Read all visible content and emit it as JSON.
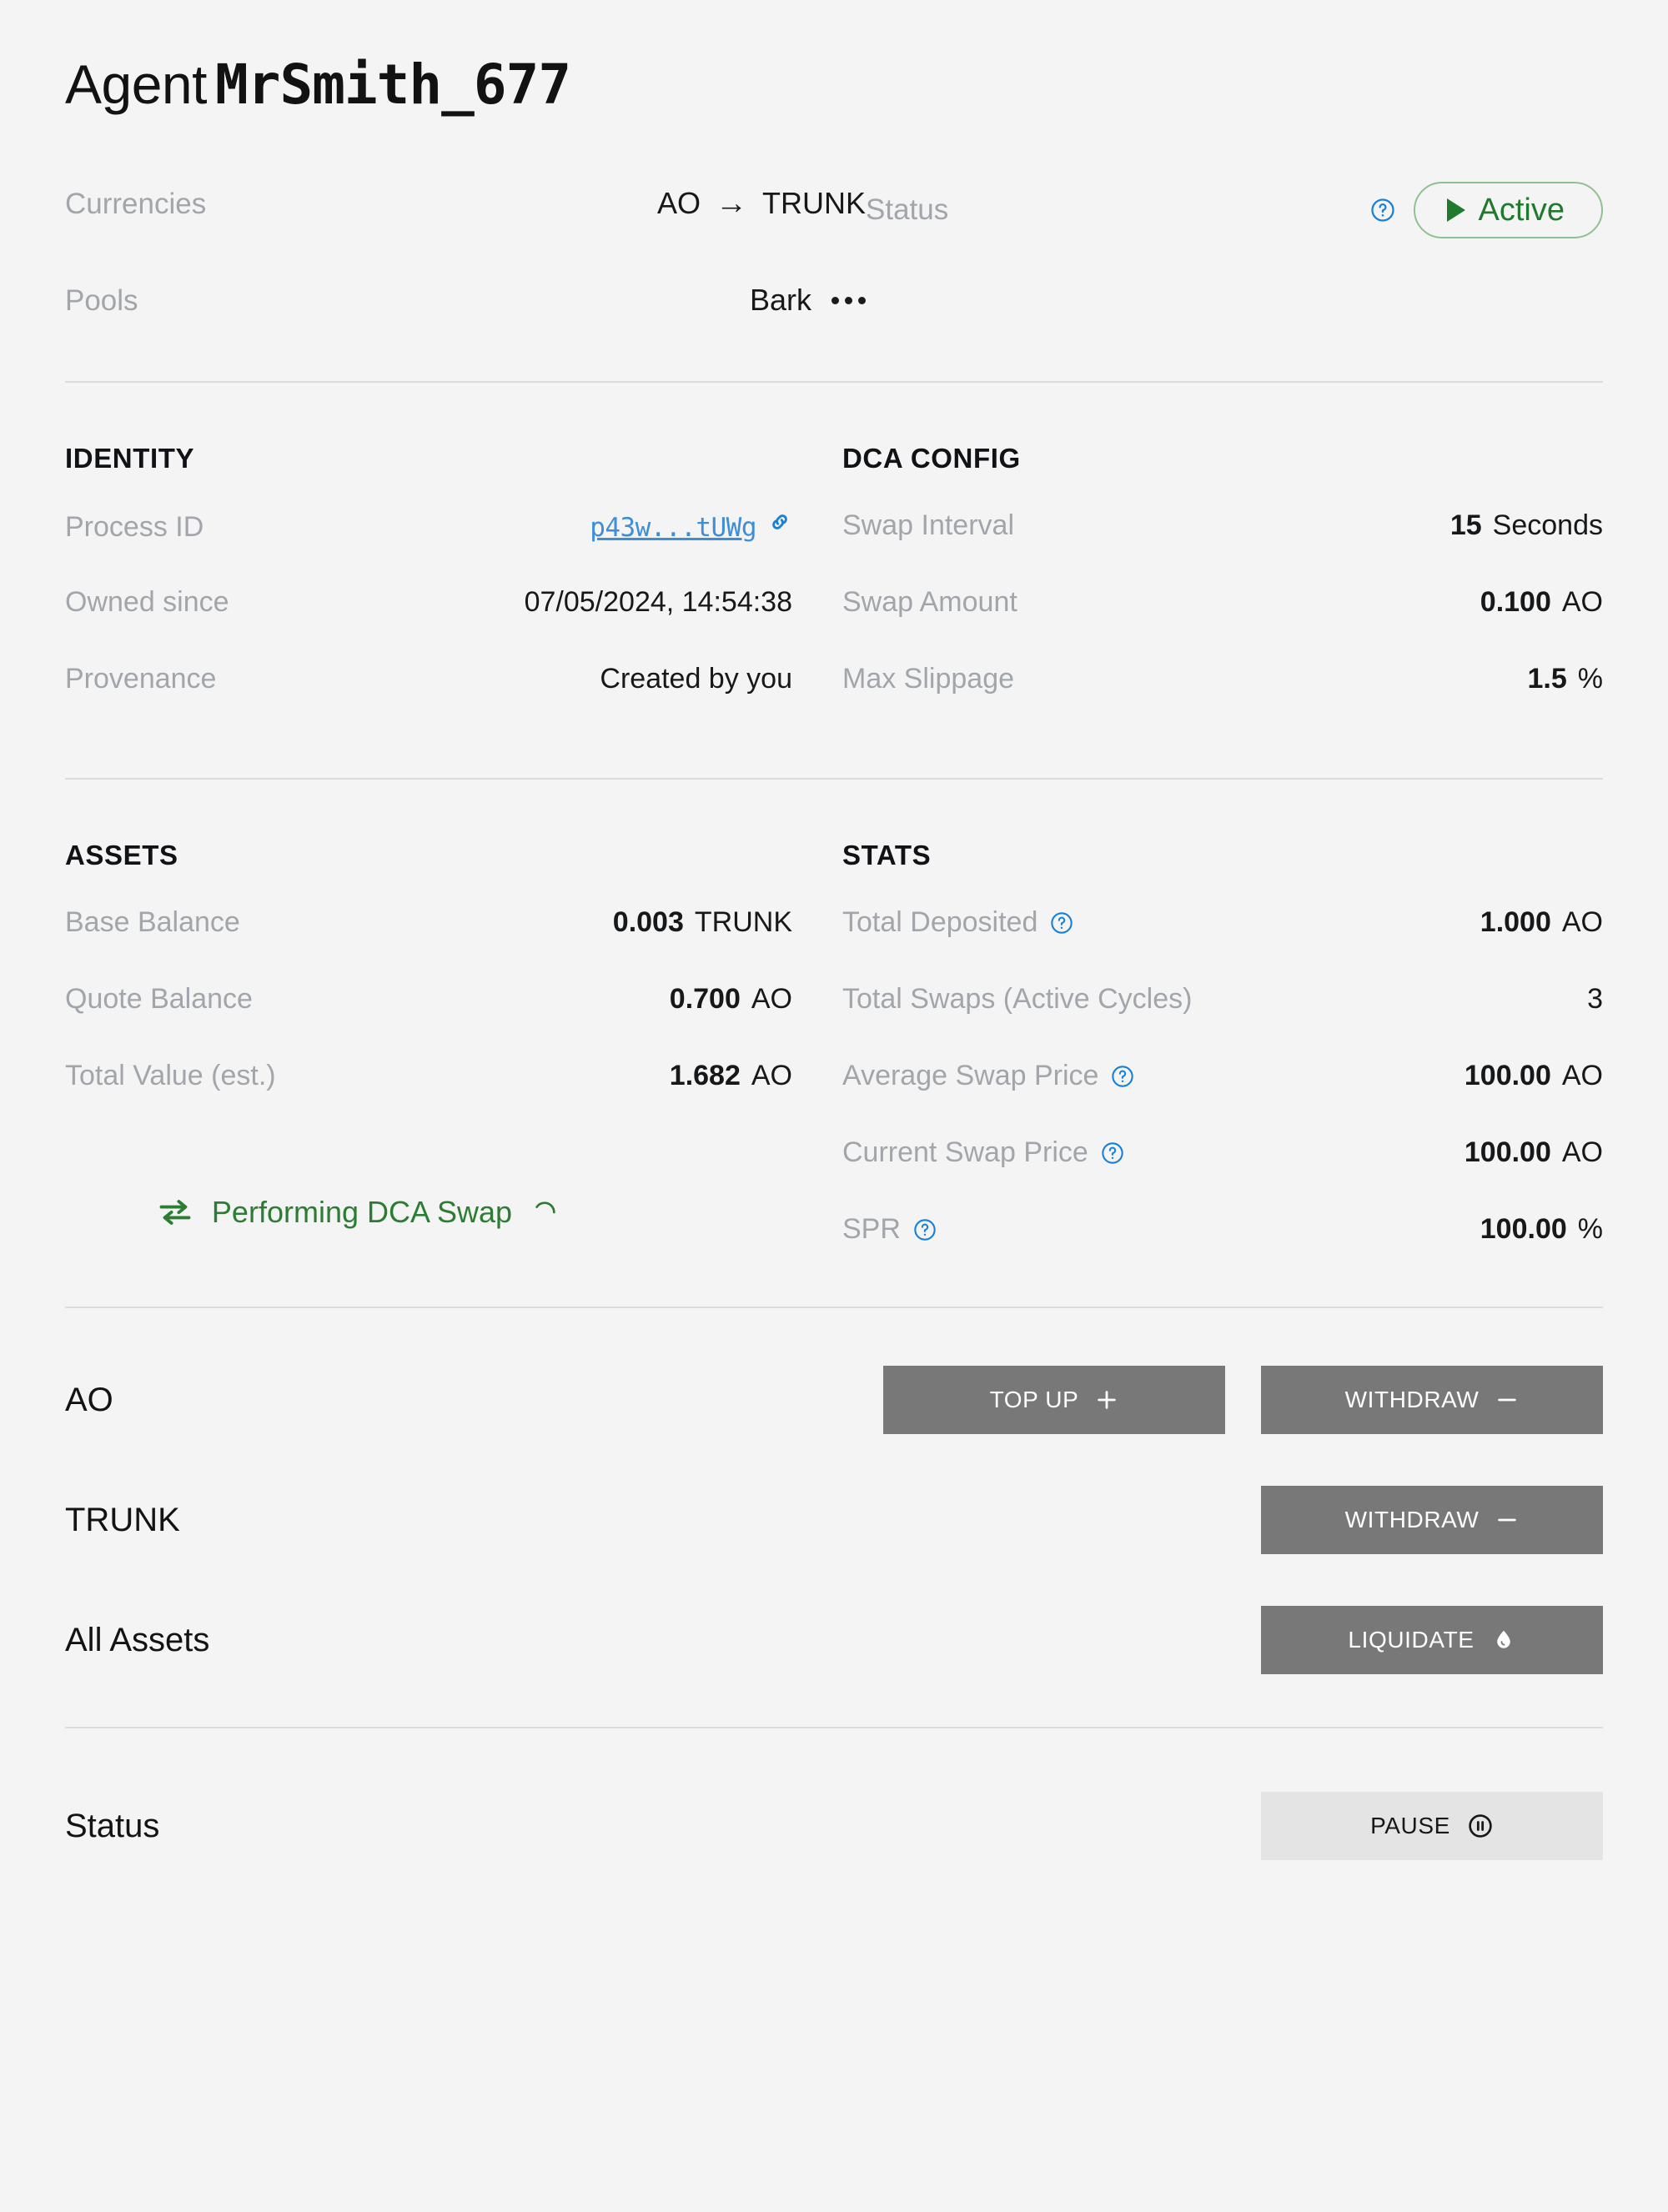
{
  "header": {
    "agent_word": "Agent",
    "agent_name": "MrSmith_677"
  },
  "summary": {
    "currencies_label": "Currencies",
    "currency_from": "AO",
    "currency_arrow": "→",
    "currency_to": "TRUNK",
    "pools_label": "Pools",
    "pools_value": "Bark",
    "pools_more_icon": "ellipsis-icon",
    "status_label": "Status",
    "status_help_icon": "help-circle-icon",
    "status_badge": "Active",
    "status_badge_color": "#1f7a2e",
    "status_badge_border": "#8fc08f"
  },
  "identity": {
    "title": "IDENTITY",
    "rows": [
      {
        "label": "Process ID",
        "value": "p43w...tUWg",
        "icon": "link-icon",
        "link": true
      },
      {
        "label": "Owned since",
        "value": "07/05/2024, 14:54:38"
      },
      {
        "label": "Provenance",
        "value": "Created by you"
      }
    ]
  },
  "dca_config": {
    "title": "DCA CONFIG",
    "rows": [
      {
        "label": "Swap Interval",
        "num": "15",
        "unit": "Seconds"
      },
      {
        "label": "Swap Amount",
        "num": "0.100",
        "unit": "AO"
      },
      {
        "label": "Max Slippage",
        "num": "1.5",
        "unit": "%"
      }
    ]
  },
  "assets": {
    "title": "ASSETS",
    "rows": [
      {
        "label": "Base Balance",
        "num": "0.003",
        "unit": "TRUNK"
      },
      {
        "label": "Quote Balance",
        "num": "0.700",
        "unit": "AO"
      },
      {
        "label": "Total Value (est.)",
        "num": "1.682",
        "unit": "AO"
      }
    ],
    "performing_text": "Performing DCA Swap",
    "performing_icon": "swap-arrows-icon",
    "performing_spinner": "spinner-icon",
    "performing_color": "#2c7d33"
  },
  "stats": {
    "title": "STATS",
    "rows": [
      {
        "label": "Total Deposited",
        "help": true,
        "num": "1.000",
        "unit": "AO"
      },
      {
        "label": "Total Swaps (Active Cycles)",
        "help": false,
        "num": "3",
        "unit": ""
      },
      {
        "label": "Average Swap Price",
        "help": true,
        "num": "100.00",
        "unit": "AO"
      },
      {
        "label": "Current Swap Price",
        "help": true,
        "num": "100.00",
        "unit": "AO"
      },
      {
        "label": "SPR",
        "help": true,
        "num": "100.00",
        "unit": "%"
      }
    ]
  },
  "actions": {
    "rows": [
      {
        "name": "AO",
        "primary": {
          "label": "TOP UP",
          "icon": "plus-icon"
        },
        "secondary": {
          "label": "WITHDRAW",
          "icon": "minus-icon"
        }
      },
      {
        "name": "TRUNK",
        "primary": null,
        "secondary": {
          "label": "WITHDRAW",
          "icon": "minus-icon"
        }
      },
      {
        "name": "All Assets",
        "primary": null,
        "secondary": {
          "label": "LIQUIDATE",
          "icon": "droplet-icon"
        }
      }
    ]
  },
  "status_control": {
    "label": "Status",
    "button_label": "PAUSE",
    "button_icon": "pause-circle-icon"
  },
  "colors": {
    "background": "#f4f4f4",
    "muted_text": "#a2a6ab",
    "body_text": "#17181a",
    "accent_blue": "#1780d8",
    "link_blue": "#3d8ed6",
    "button_gray": "#787878",
    "button_light": "#e4e4e4",
    "divider": "#dcdcdc"
  }
}
